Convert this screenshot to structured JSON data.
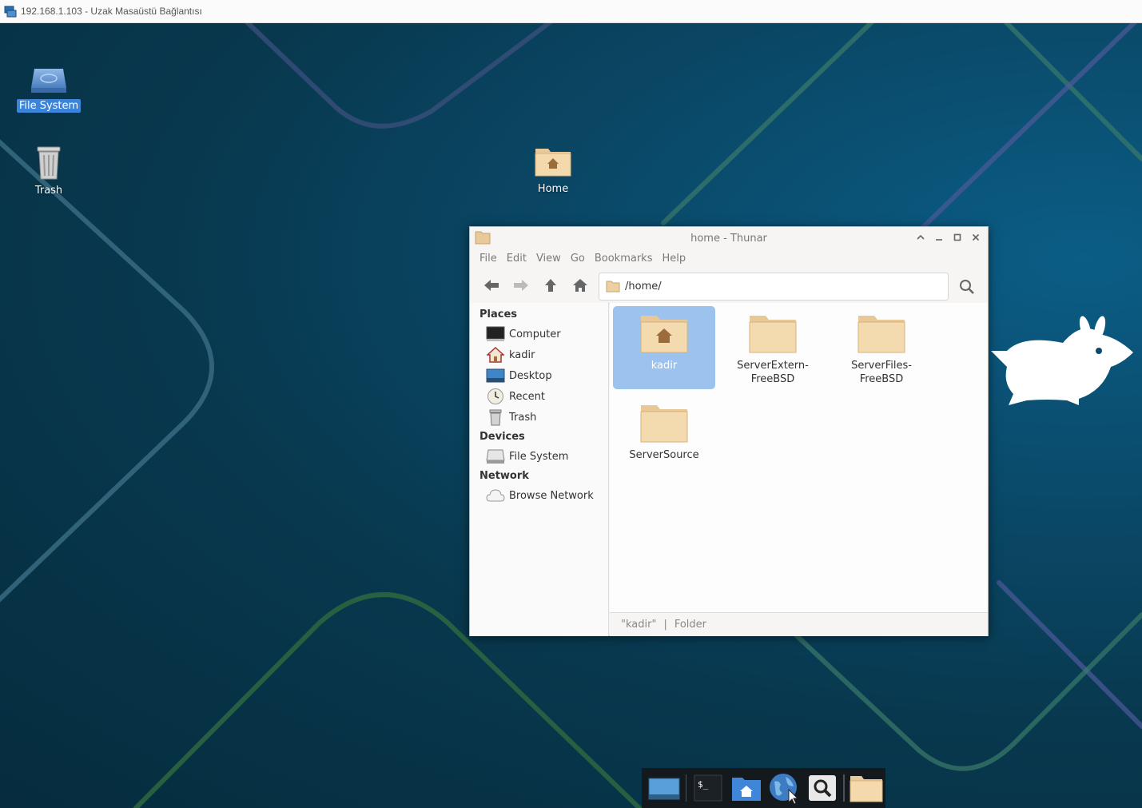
{
  "rdp": {
    "title": "192.168.1.103 - Uzak Masaüstü Bağlantısı"
  },
  "desktop": {
    "icons": [
      {
        "label": "File System",
        "icon": "drive-icon",
        "selected": true
      },
      {
        "label": "Trash",
        "icon": "trash-icon",
        "selected": false
      },
      {
        "label": "Home",
        "icon": "home-folder-icon",
        "selected": false
      }
    ]
  },
  "window": {
    "title": "home - Thunar",
    "menu": [
      "File",
      "Edit",
      "View",
      "Go",
      "Bookmarks",
      "Help"
    ],
    "path": "/home/",
    "sidebar": {
      "places_heading": "Places",
      "places": [
        "Computer",
        "kadir",
        "Desktop",
        "Recent",
        "Trash"
      ],
      "devices_heading": "Devices",
      "devices": [
        "File System"
      ],
      "network_heading": "Network",
      "network": [
        "Browse Network"
      ]
    },
    "items": [
      {
        "name": "kadir",
        "type": "home-folder",
        "selected": true
      },
      {
        "name": "ServerExtern-FreeBSD",
        "type": "folder",
        "selected": false
      },
      {
        "name": "ServerFiles-FreeBSD",
        "type": "folder",
        "selected": false
      },
      {
        "name": "ServerSource",
        "type": "folder",
        "selected": false
      }
    ],
    "status": {
      "name": "\"kadir\"",
      "separator": "|",
      "type": "Folder"
    }
  },
  "dock": {
    "items": [
      "show-desktop-icon",
      "terminal-icon",
      "home-folder-icon",
      "web-browser-icon",
      "app-finder-icon",
      "file-manager-icon"
    ]
  },
  "colors": {
    "desktop_bg": "#0a4a6a",
    "selection": "#9bc3ee",
    "desktop_selection": "#3b84d9"
  }
}
